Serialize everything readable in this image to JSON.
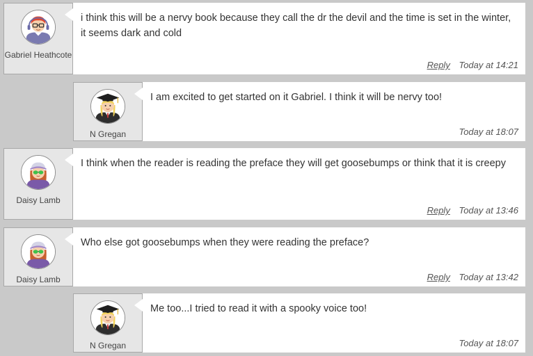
{
  "comments": [
    {
      "author": "Gabriel Heathcote",
      "avatar_icon": "student-boy-glasses-icon",
      "text": "i think  this will be a nervy book because they call the dr the devil and the time is set in the winter, it seems dark and cold",
      "reply_label": "Reply",
      "time": "Today at 14:21"
    },
    {
      "author": "N Gregan",
      "avatar_icon": "graduate-teacher-icon",
      "text": "I am excited to get started on it Gabriel. I think it will be nervy too!",
      "time": "Today at 18:07"
    },
    {
      "author": "Daisy Lamb",
      "avatar_icon": "student-girl-sunglasses-icon",
      "text": "I think when the reader is reading the preface they will get goosebumps or think that it is creepy",
      "reply_label": "Reply",
      "time": "Today at 13:46"
    },
    {
      "author": "Daisy Lamb",
      "avatar_icon": "student-girl-sunglasses-icon",
      "text": "Who else got goosebumps when they were reading the preface?",
      "reply_label": "Reply",
      "time": "Today at 13:42"
    },
    {
      "author": "N Gregan",
      "avatar_icon": "graduate-teacher-icon",
      "text": "Me too...I tried to read it with a spooky voice too!",
      "time": "Today at 18:07"
    }
  ]
}
